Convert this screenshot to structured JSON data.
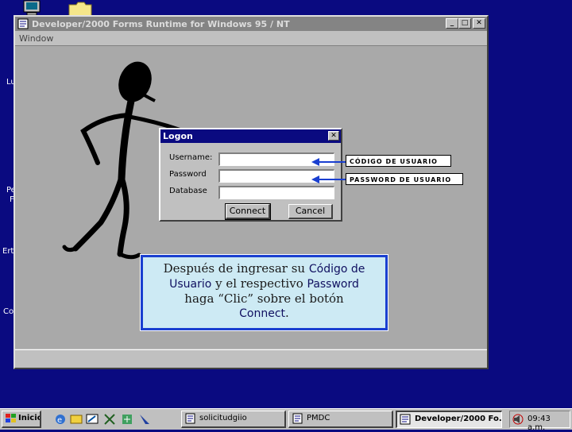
{
  "window": {
    "title": "Developer/2000 Forms Runtime for Windows 95 / NT",
    "menu": "Window",
    "buttons": {
      "minimize": "_",
      "maximize": "□",
      "close": "✕"
    }
  },
  "desktop_fragments": [
    "Lu",
    "Pe",
    "F",
    "Ert",
    "Co"
  ],
  "logon": {
    "title": "Logon",
    "close": "✕",
    "username_label": "Username:",
    "password_label": "Password",
    "database_label": "Database",
    "username_value": "",
    "password_value": "",
    "database_value": "",
    "connect_label": "Connect",
    "cancel_label": "Cancel"
  },
  "callouts": {
    "username": "CÓDIGO DE USUARIO",
    "password": "PASSWORD DE USUARIO"
  },
  "instruction": {
    "line1a": "Después de ingresar su ",
    "line1b": "Código de",
    "line2a": "Usuario",
    "line2b": " y el respectivo ",
    "line2c": "Password",
    "line3": "haga “Clic” sobre el botón",
    "line4a": "Connect",
    "line4b": "."
  },
  "taskbar": {
    "start": "Inicio",
    "tasks": [
      "solicitudgiio",
      "PMDC",
      "Developer/2000 Fo..."
    ],
    "clock": "09:43 a.m."
  },
  "colors": {
    "desktop": "#0a0a80",
    "instruction_border": "#1a3fd0",
    "instruction_bg": "#cdeaf4"
  }
}
